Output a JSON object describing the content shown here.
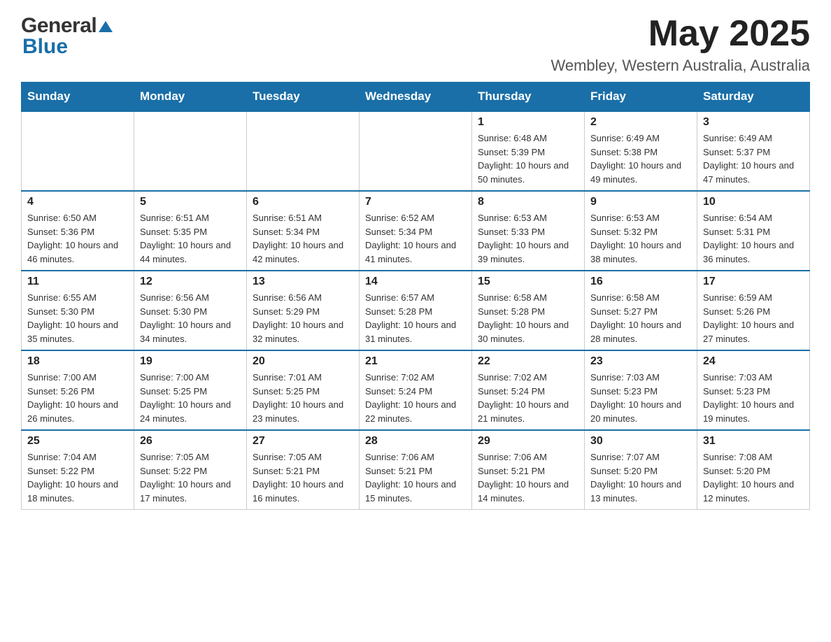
{
  "header": {
    "logo_general": "General",
    "logo_triangle": "▶",
    "logo_blue": "Blue",
    "main_title": "May 2025",
    "subtitle": "Wembley, Western Australia, Australia"
  },
  "calendar": {
    "days_of_week": [
      "Sunday",
      "Monday",
      "Tuesday",
      "Wednesday",
      "Thursday",
      "Friday",
      "Saturday"
    ],
    "weeks": [
      [
        {
          "day": "",
          "sunrise": "",
          "sunset": "",
          "daylight": ""
        },
        {
          "day": "",
          "sunrise": "",
          "sunset": "",
          "daylight": ""
        },
        {
          "day": "",
          "sunrise": "",
          "sunset": "",
          "daylight": ""
        },
        {
          "day": "",
          "sunrise": "",
          "sunset": "",
          "daylight": ""
        },
        {
          "day": "1",
          "sunrise": "Sunrise: 6:48 AM",
          "sunset": "Sunset: 5:39 PM",
          "daylight": "Daylight: 10 hours and 50 minutes."
        },
        {
          "day": "2",
          "sunrise": "Sunrise: 6:49 AM",
          "sunset": "Sunset: 5:38 PM",
          "daylight": "Daylight: 10 hours and 49 minutes."
        },
        {
          "day": "3",
          "sunrise": "Sunrise: 6:49 AM",
          "sunset": "Sunset: 5:37 PM",
          "daylight": "Daylight: 10 hours and 47 minutes."
        }
      ],
      [
        {
          "day": "4",
          "sunrise": "Sunrise: 6:50 AM",
          "sunset": "Sunset: 5:36 PM",
          "daylight": "Daylight: 10 hours and 46 minutes."
        },
        {
          "day": "5",
          "sunrise": "Sunrise: 6:51 AM",
          "sunset": "Sunset: 5:35 PM",
          "daylight": "Daylight: 10 hours and 44 minutes."
        },
        {
          "day": "6",
          "sunrise": "Sunrise: 6:51 AM",
          "sunset": "Sunset: 5:34 PM",
          "daylight": "Daylight: 10 hours and 42 minutes."
        },
        {
          "day": "7",
          "sunrise": "Sunrise: 6:52 AM",
          "sunset": "Sunset: 5:34 PM",
          "daylight": "Daylight: 10 hours and 41 minutes."
        },
        {
          "day": "8",
          "sunrise": "Sunrise: 6:53 AM",
          "sunset": "Sunset: 5:33 PM",
          "daylight": "Daylight: 10 hours and 39 minutes."
        },
        {
          "day": "9",
          "sunrise": "Sunrise: 6:53 AM",
          "sunset": "Sunset: 5:32 PM",
          "daylight": "Daylight: 10 hours and 38 minutes."
        },
        {
          "day": "10",
          "sunrise": "Sunrise: 6:54 AM",
          "sunset": "Sunset: 5:31 PM",
          "daylight": "Daylight: 10 hours and 36 minutes."
        }
      ],
      [
        {
          "day": "11",
          "sunrise": "Sunrise: 6:55 AM",
          "sunset": "Sunset: 5:30 PM",
          "daylight": "Daylight: 10 hours and 35 minutes."
        },
        {
          "day": "12",
          "sunrise": "Sunrise: 6:56 AM",
          "sunset": "Sunset: 5:30 PM",
          "daylight": "Daylight: 10 hours and 34 minutes."
        },
        {
          "day": "13",
          "sunrise": "Sunrise: 6:56 AM",
          "sunset": "Sunset: 5:29 PM",
          "daylight": "Daylight: 10 hours and 32 minutes."
        },
        {
          "day": "14",
          "sunrise": "Sunrise: 6:57 AM",
          "sunset": "Sunset: 5:28 PM",
          "daylight": "Daylight: 10 hours and 31 minutes."
        },
        {
          "day": "15",
          "sunrise": "Sunrise: 6:58 AM",
          "sunset": "Sunset: 5:28 PM",
          "daylight": "Daylight: 10 hours and 30 minutes."
        },
        {
          "day": "16",
          "sunrise": "Sunrise: 6:58 AM",
          "sunset": "Sunset: 5:27 PM",
          "daylight": "Daylight: 10 hours and 28 minutes."
        },
        {
          "day": "17",
          "sunrise": "Sunrise: 6:59 AM",
          "sunset": "Sunset: 5:26 PM",
          "daylight": "Daylight: 10 hours and 27 minutes."
        }
      ],
      [
        {
          "day": "18",
          "sunrise": "Sunrise: 7:00 AM",
          "sunset": "Sunset: 5:26 PM",
          "daylight": "Daylight: 10 hours and 26 minutes."
        },
        {
          "day": "19",
          "sunrise": "Sunrise: 7:00 AM",
          "sunset": "Sunset: 5:25 PM",
          "daylight": "Daylight: 10 hours and 24 minutes."
        },
        {
          "day": "20",
          "sunrise": "Sunrise: 7:01 AM",
          "sunset": "Sunset: 5:25 PM",
          "daylight": "Daylight: 10 hours and 23 minutes."
        },
        {
          "day": "21",
          "sunrise": "Sunrise: 7:02 AM",
          "sunset": "Sunset: 5:24 PM",
          "daylight": "Daylight: 10 hours and 22 minutes."
        },
        {
          "day": "22",
          "sunrise": "Sunrise: 7:02 AM",
          "sunset": "Sunset: 5:24 PM",
          "daylight": "Daylight: 10 hours and 21 minutes."
        },
        {
          "day": "23",
          "sunrise": "Sunrise: 7:03 AM",
          "sunset": "Sunset: 5:23 PM",
          "daylight": "Daylight: 10 hours and 20 minutes."
        },
        {
          "day": "24",
          "sunrise": "Sunrise: 7:03 AM",
          "sunset": "Sunset: 5:23 PM",
          "daylight": "Daylight: 10 hours and 19 minutes."
        }
      ],
      [
        {
          "day": "25",
          "sunrise": "Sunrise: 7:04 AM",
          "sunset": "Sunset: 5:22 PM",
          "daylight": "Daylight: 10 hours and 18 minutes."
        },
        {
          "day": "26",
          "sunrise": "Sunrise: 7:05 AM",
          "sunset": "Sunset: 5:22 PM",
          "daylight": "Daylight: 10 hours and 17 minutes."
        },
        {
          "day": "27",
          "sunrise": "Sunrise: 7:05 AM",
          "sunset": "Sunset: 5:21 PM",
          "daylight": "Daylight: 10 hours and 16 minutes."
        },
        {
          "day": "28",
          "sunrise": "Sunrise: 7:06 AM",
          "sunset": "Sunset: 5:21 PM",
          "daylight": "Daylight: 10 hours and 15 minutes."
        },
        {
          "day": "29",
          "sunrise": "Sunrise: 7:06 AM",
          "sunset": "Sunset: 5:21 PM",
          "daylight": "Daylight: 10 hours and 14 minutes."
        },
        {
          "day": "30",
          "sunrise": "Sunrise: 7:07 AM",
          "sunset": "Sunset: 5:20 PM",
          "daylight": "Daylight: 10 hours and 13 minutes."
        },
        {
          "day": "31",
          "sunrise": "Sunrise: 7:08 AM",
          "sunset": "Sunset: 5:20 PM",
          "daylight": "Daylight: 10 hours and 12 minutes."
        }
      ]
    ]
  }
}
